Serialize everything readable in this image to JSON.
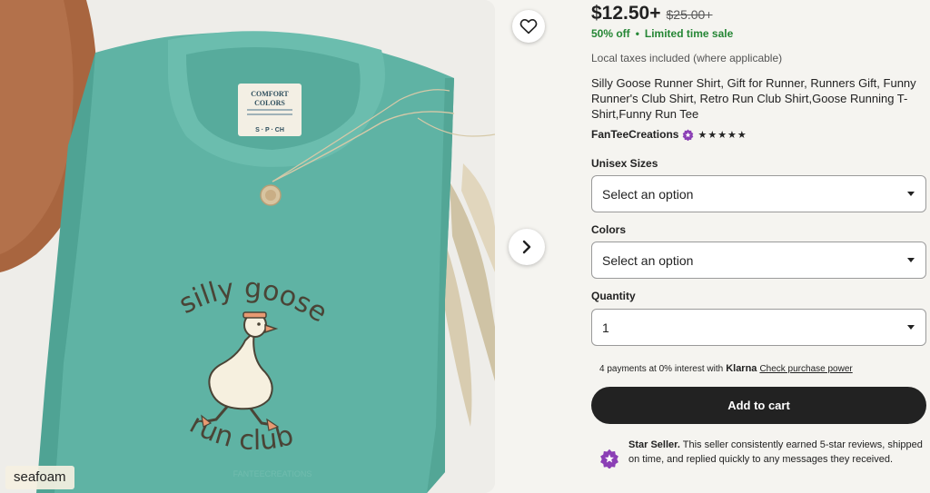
{
  "media": {
    "variant_label": "seafoam",
    "shirt_text_line1": "silly goose",
    "shirt_text_line2": "run club",
    "tag_text_1": "COMFORT",
    "tag_text_2": "COLORS",
    "tag_sizes": "S · P · CH",
    "icons": {
      "favorite": "heart-icon",
      "next": "chevron-right-icon"
    }
  },
  "listing": {
    "price": "$12.50+",
    "original_price": "$25.00+",
    "discount": "50% off",
    "sale_note": "Limited time sale",
    "taxes": "Local taxes included (where applicable)",
    "title": "Silly Goose Runner Shirt, Gift for Runner, Runners Gift, Funny Runner's Club Shirt, Retro Run Club Shirt,Goose Running T-Shirt,Funny Run Tee",
    "shop_name": "FanTeeCreations",
    "rating_stars": "★★★★★",
    "rating": 5
  },
  "options": {
    "sizes_label": "Unisex Sizes",
    "sizes_value": "Select an option",
    "colors_label": "Colors",
    "colors_value": "Select an option",
    "quantity_label": "Quantity",
    "quantity_value": "1"
  },
  "payment": {
    "klarna_prefix": "4 payments at 0% interest with",
    "klarna_brand": "Klarna",
    "klarna_link": "Check purchase power"
  },
  "cart": {
    "add_label": "Add to cart"
  },
  "star_seller": {
    "title": "Star Seller.",
    "text": "This seller consistently earned 5-star reviews, shipped on time, and replied quickly to any messages they received."
  },
  "colors": {
    "sale_green": "#258635",
    "button_dark": "#222222",
    "star_seller_purple": "#8b3fb5",
    "shirt": "#5fb3a4"
  }
}
